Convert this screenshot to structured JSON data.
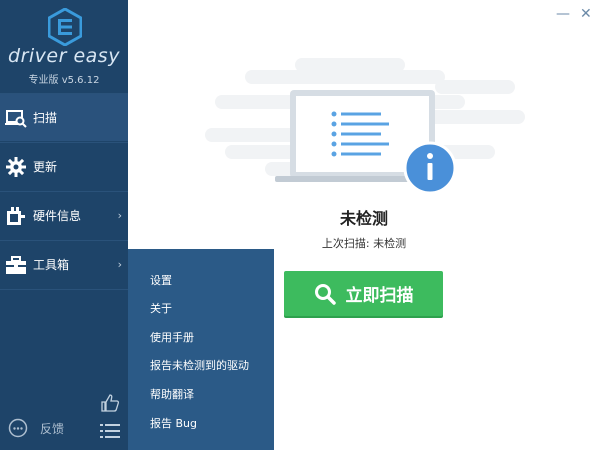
{
  "app": {
    "brand": "driver easy",
    "edition": "专业版 v5.6.12"
  },
  "window": {
    "minimize_glyph": "—",
    "close_glyph": "✕"
  },
  "sidebar": {
    "items": [
      {
        "label": "扫描",
        "icon": "scan-icon"
      },
      {
        "label": "更新",
        "icon": "gear-icon"
      },
      {
        "label": "硬件信息",
        "icon": "hardware-icon"
      },
      {
        "label": "工具箱",
        "icon": "toolbox-icon"
      }
    ],
    "feedback_label": "反馈"
  },
  "tools_menu": {
    "items": [
      "设置",
      "关于",
      "使用手册",
      "报告未检测到的驱动",
      "帮助翻译",
      "报告 Bug"
    ]
  },
  "main": {
    "status_title": "未检测",
    "last_scan": "上次扫描: 未检测",
    "scan_button_label": "立即扫描"
  },
  "colors": {
    "sidebar_bg": "#1e4469",
    "active_bg": "#2a527c",
    "menu_bg": "#2b5a87",
    "scan_green": "#3dbb5e",
    "info_blue": "#4a90d9"
  }
}
